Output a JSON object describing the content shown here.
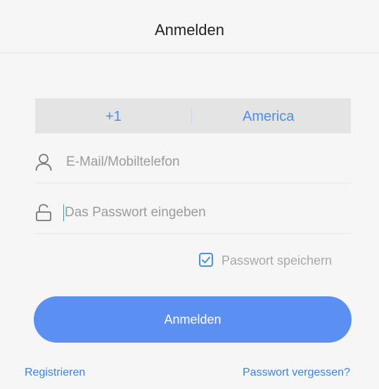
{
  "header": {
    "title": "Anmelden"
  },
  "country": {
    "code": "+1",
    "name": "America"
  },
  "form": {
    "email_placeholder": "E-Mail/Mobiltelefon",
    "password_placeholder": "Das Passwort eingeben",
    "remember_label": "Passwort speichern",
    "remember_checked": true,
    "login_label": "Anmelden"
  },
  "links": {
    "register": "Registrieren",
    "forgot": "Passwort vergessen?"
  },
  "icons": {
    "email": "user-icon",
    "password": "lock-icon",
    "remember": "checkbox-checked-icon"
  },
  "colors": {
    "accent": "#4a90e2",
    "button": "#5b8ff2",
    "background": "#f6f6f6",
    "country_bg": "#e4e4e4"
  }
}
